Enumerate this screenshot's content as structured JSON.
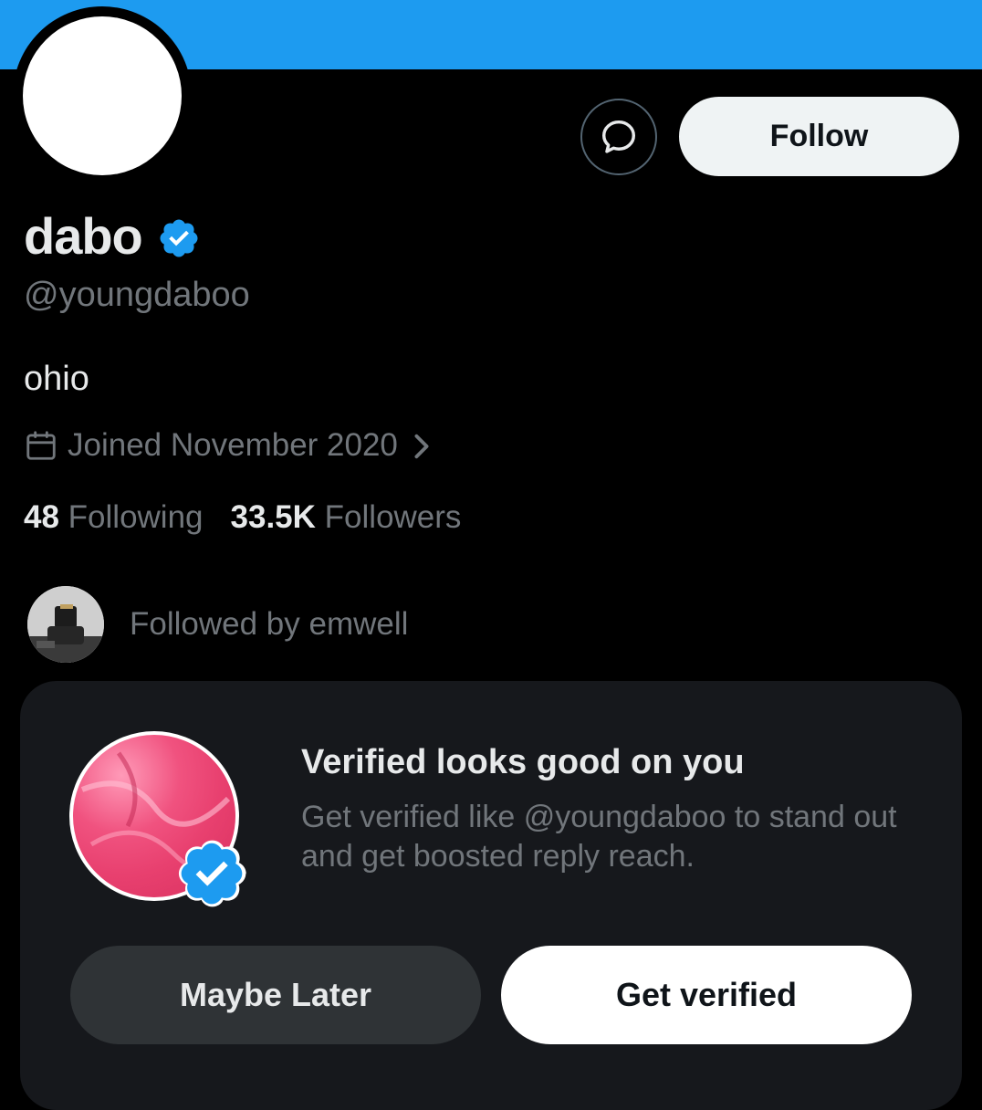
{
  "profile": {
    "display_name": "dabo",
    "handle": "@youngdaboo",
    "bio": "ohio",
    "joined": "Joined November 2020",
    "following_count": "48",
    "following_label": "Following",
    "followers_count": "33.5K",
    "followers_label": "Followers",
    "followed_by": "Followed by emwell"
  },
  "actions": {
    "follow_label": "Follow"
  },
  "promo": {
    "title": "Verified looks good on you",
    "description": "Get verified like @youngdaboo to stand out and get boosted reply reach.",
    "maybe_later_label": "Maybe Later",
    "get_verified_label": "Get verified"
  },
  "colors": {
    "banner": "#1d9bf0",
    "background": "#000000",
    "verified_blue": "#1d9bf0",
    "secondary_text": "#71767b",
    "card_background": "#16181c"
  },
  "icons": [
    "message-icon",
    "verified-badge-icon",
    "calendar-icon",
    "chevron-right-icon"
  ]
}
